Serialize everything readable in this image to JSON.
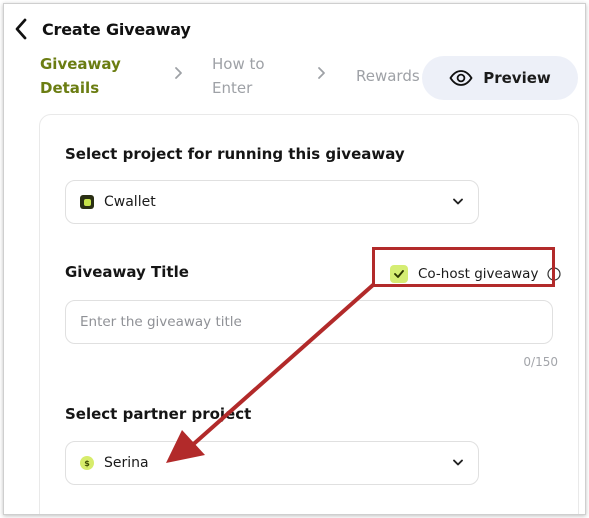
{
  "header": {
    "title": "Create Giveaway",
    "back_icon": "chevron-left-icon"
  },
  "stepper": {
    "steps": [
      {
        "line1": "Giveaway",
        "line2": "Details",
        "state": "active"
      },
      {
        "line1": "How to",
        "line2": "Enter",
        "state": "inactive"
      },
      {
        "line1": "Rewards",
        "line2": "",
        "state": "inactive"
      }
    ],
    "separator_icon": "chevron-right-icon"
  },
  "preview_button": {
    "label": "Preview",
    "icon": "eye-icon"
  },
  "form": {
    "project_section": {
      "label": "Select project for running this giveaway",
      "selected_value": "Cwallet",
      "icon": "cwallet-logo-icon"
    },
    "title_section": {
      "label": "Giveaway Title",
      "placeholder": "Enter the giveaway title",
      "value": "",
      "counter": "0/150"
    },
    "cohost": {
      "label": "Co-host giveaway",
      "checked": true,
      "info_icon": "info-icon"
    },
    "partner_section": {
      "label": "Select partner project",
      "selected_value": "Serina",
      "icon": "serina-logo-icon"
    }
  },
  "colors": {
    "accent": "#6b7d12",
    "checkbox": "#d5ed73",
    "preview_bg": "#edf0f8",
    "annotation": "#b22a2a"
  }
}
